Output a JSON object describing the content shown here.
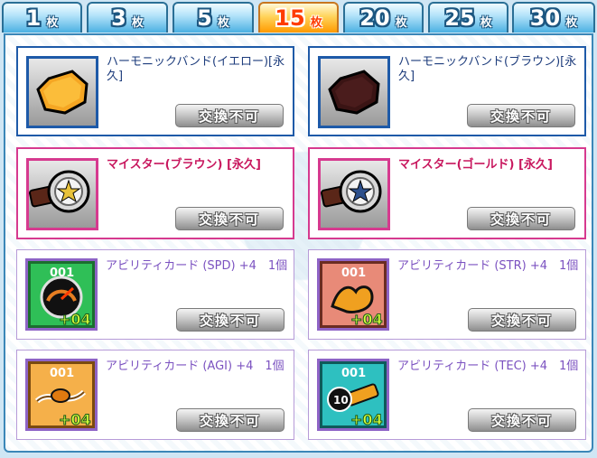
{
  "tabs": [
    {
      "num": "1",
      "unit": "枚",
      "active": false
    },
    {
      "num": "3",
      "unit": "枚",
      "active": false
    },
    {
      "num": "5",
      "unit": "枚",
      "active": false
    },
    {
      "num": "15",
      "unit": "枚",
      "active": true
    },
    {
      "num": "20",
      "unit": "枚",
      "active": false
    },
    {
      "num": "25",
      "unit": "枚",
      "active": false
    },
    {
      "num": "30",
      "unit": "枚",
      "active": false
    }
  ],
  "items": [
    {
      "name": "ハーモニックバンド(イエロー)[永久]",
      "button": "交換不可",
      "icon": "yellow-band-icon"
    },
    {
      "name": "ハーモニックバンド(ブラウン)[永久]",
      "button": "交換不可",
      "icon": "brown-band-icon"
    },
    {
      "name": "マイスター(ブラウン) [永久]",
      "button": "交換不可",
      "icon": "watch-gold-star-icon"
    },
    {
      "name": "マイスター(ゴールド) [永久]",
      "button": "交換不可",
      "icon": "watch-blue-star-icon"
    },
    {
      "name": "アビリティカード (SPD) +4　1個",
      "button": "交換不可",
      "icon": "speedometer-card-icon",
      "card_no": "001",
      "card_plus": "+04"
    },
    {
      "name": "アビリティカード (STR) +4　1個",
      "button": "交換不可",
      "icon": "muscle-card-icon",
      "card_no": "001",
      "card_plus": "+04"
    },
    {
      "name": "アビリティカード (AGI) +4　1個",
      "button": "交換不可",
      "icon": "agility-card-icon",
      "card_no": "001",
      "card_plus": "+04"
    },
    {
      "name": "アビリティカード (TEC) +4　1個",
      "button": "交換不可",
      "icon": "technique-card-icon",
      "card_no": "001",
      "card_plus": "+04",
      "badge": "10"
    }
  ],
  "colors": {
    "blue_border": "#1e5aa8",
    "pink_border": "#d63a8f",
    "purple_border": "#b79bd8",
    "active_tab": "#ff9a00"
  }
}
